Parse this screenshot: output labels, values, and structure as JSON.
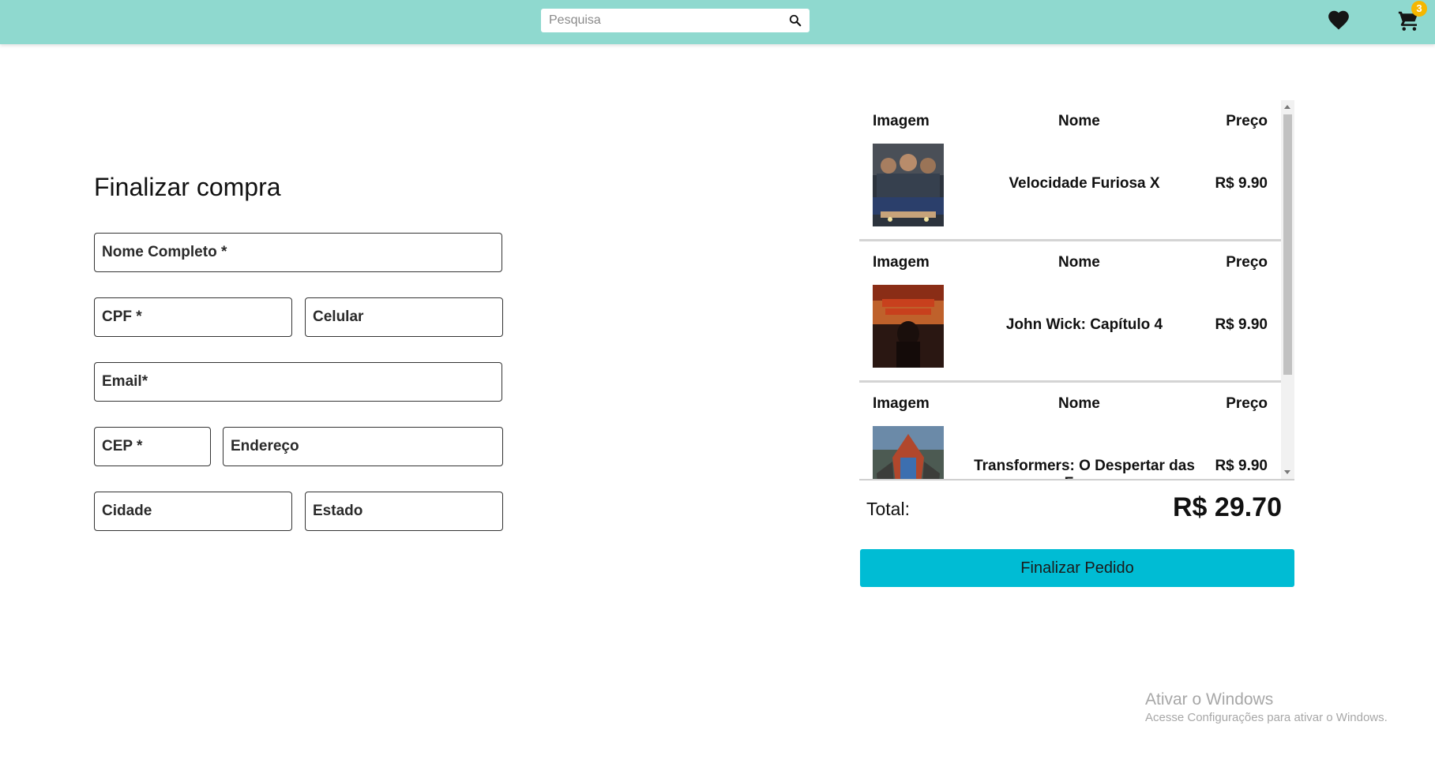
{
  "header": {
    "search": {
      "placeholder": "Pesquisa",
      "value": ""
    },
    "cart_count": "3",
    "colors": {
      "bar": "#8fd9cf",
      "badge": "#f5b700"
    }
  },
  "form": {
    "title": "Finalizar compra",
    "fields": {
      "nome": "Nome Completo *",
      "cpf": "CPF *",
      "celular": "Celular",
      "email": "Email*",
      "cep": "CEP *",
      "endereco": "Endereço",
      "cidade": "Cidade",
      "estado": "Estado"
    }
  },
  "order": {
    "headers": {
      "image": "Imagem",
      "name": "Nome",
      "price": "Preço"
    },
    "items": [
      {
        "name": "Velocidade Furiosa X",
        "price": "R$ 9.90",
        "poster_colors": [
          "#3a4250",
          "#c7a37a",
          "#2b3f6b"
        ]
      },
      {
        "name": "John Wick: Capítulo 4",
        "price": "R$ 9.90",
        "poster_colors": [
          "#2a1712",
          "#c8401d",
          "#e2833a"
        ]
      },
      {
        "name": "Transformers: O Despertar das Feras",
        "price": "R$ 9.90",
        "poster_colors": [
          "#6b8aa8",
          "#b1472c",
          "#3c3d3a"
        ]
      }
    ],
    "total_label": "Total:",
    "total_value": "R$ 29.70",
    "finish_label": "Finalizar Pedido",
    "finish_color": "#00bcd4"
  },
  "watermark": {
    "title": "Ativar o Windows",
    "subtitle": "Acesse Configurações para ativar o Windows."
  }
}
